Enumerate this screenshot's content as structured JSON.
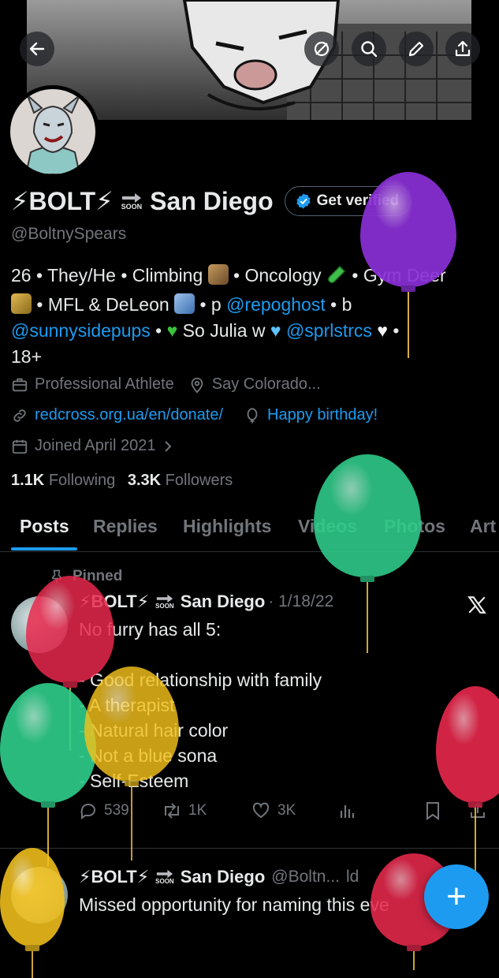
{
  "header": {
    "back_icon": "arrow-left-icon",
    "buttons": [
      "hide-icon",
      "search-icon",
      "edit-icon",
      "share-icon"
    ]
  },
  "profile": {
    "display_name": "⚡BOLT⚡",
    "soon_badge": "SOON",
    "location_name": "San Diego",
    "verified_label": "Get verified",
    "handle": "@BoltnySpears",
    "bio": {
      "line1_a": "26 • They/He • Climbing",
      "line1_b": " • Oncology",
      "line1_c": " • Gym Deer",
      "line2_a": " • MFL & DeLeon",
      "line2_b": " • p ",
      "mention1": "@repoghost",
      "line2_c": " • b",
      "mention2": "@sunnysidepups",
      "line3_a": " • ",
      "line3_b": " So Julia w ",
      "mention3": "@sprlstrcs",
      "line3_c": " •",
      "line4": "18+"
    },
    "category": "Professional Athlete",
    "location": "Say Colorado...",
    "website": "redcross.org.ua/en/donate/",
    "birthday": "Happy birthday!",
    "joined": "Joined April 2021",
    "following_count": "1.1K",
    "following_label": "Following",
    "followers_count": "3.3K",
    "followers_label": "Followers"
  },
  "tabs": [
    "Posts",
    "Replies",
    "Highlights",
    "Videos",
    "Photos",
    "Art"
  ],
  "pinned_label": "Pinned",
  "post1": {
    "name": "⚡BOLT⚡",
    "soon": "SOON",
    "place": "San Diego",
    "date": "· 1/18/22",
    "lines": [
      "No furry has all 5:",
      "",
      "- Good relationship with family",
      "- A therapist",
      "- Natural hair color",
      "- Not a blue sona",
      "- Self-Esteem"
    ],
    "replies": "539",
    "reposts": "1K",
    "likes": "3K"
  },
  "post2": {
    "name": "⚡BOLT⚡",
    "soon": "SOON",
    "place": "San Diego",
    "handle": "@Boltn...",
    "timefrag": "ld",
    "text": "Missed opportunity for naming this eve"
  },
  "fab_label": "+",
  "colors": {
    "accent": "#1d9bf0",
    "background": "#000000",
    "text": "#e7e9ea",
    "muted": "#71767b",
    "balloon_purple": "#8a2fd6",
    "balloon_green": "#2fcf8c",
    "balloon_red": "#e8294d",
    "balloon_yellow": "#f3c11c"
  }
}
